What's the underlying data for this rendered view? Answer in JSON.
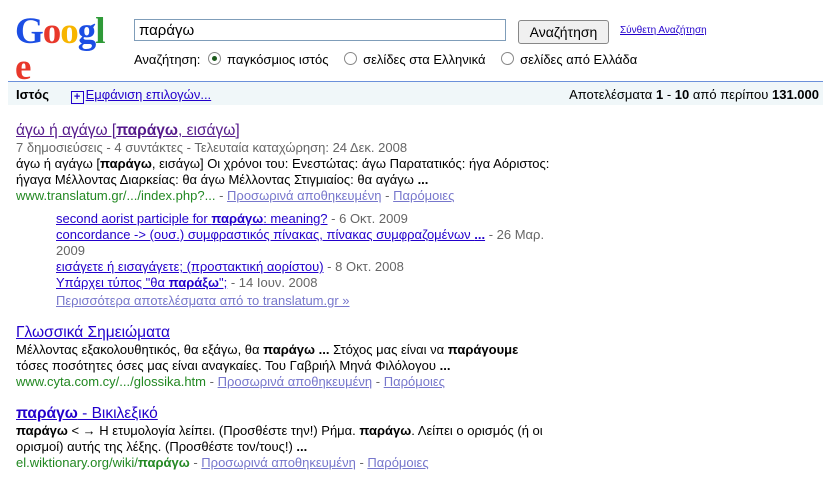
{
  "logo": "Google",
  "search": {
    "query": "παράγω",
    "button": "Αναζήτηση",
    "advanced": "Σύνθετη Αναζήτηση"
  },
  "scope": {
    "label": "Αναζήτηση:",
    "options": [
      "παγκόσμιος ιστός",
      "σελίδες στα Ελληνικά",
      "σελίδες από Ελλάδα"
    ],
    "selected": 0
  },
  "bar": {
    "tab": "Ιστός",
    "options_link": "Εμφάνιση επιλογών...",
    "stats_prefix": "Αποτελέσματα",
    "from": "1",
    "dash": "-",
    "to": "10",
    "about": "από περίπου",
    "total": "131.000"
  },
  "results": [
    {
      "title_pre": "άγω ή αγάγω [",
      "title_bold": "παράγω",
      "title_post": ", εισάγω]",
      "meta": "7 δημοσιεύσεις - 4 συντάκτες - Τελευταία καταχώρηση: 24 Δεκ. 2008",
      "snip1_pre": "άγω ή αγάγω [",
      "snip1_bold": "παράγω",
      "snip1_post": ", εισάγω] Οι χρόνοι του: Ενεστώτας: άγω Παρατατικός: ήγα Αόριστος:",
      "snip2_pre": "ήγαγα Μέλλοντας Διαρκείας: θα άγω Μέλλοντας Στιγμιαίος: θα αγάγω ",
      "snip2_bold": "...",
      "url": "www.translatum.gr/.../index.php?...",
      "cache": "Προσωρινά αποθηκευμένη",
      "similar": "Παρόμοιες",
      "sub": [
        {
          "pre": "second aorist participle for ",
          "bold": "παράγω",
          "post": ": meaning?",
          "date": "- 6 Οκτ. 2009"
        },
        {
          "pre": "concordance -> (ουσ.) συμφραστικός πίνακας, πίνακας συμφραζομένων ",
          "bold": "...",
          "post": "",
          "date": "- 26 Μαρ.",
          "date2": "2009"
        },
        {
          "pre": "εισάγετε ή εισαγάγετε; (προστακτική αορίστου)",
          "bold": "",
          "post": "",
          "date": "- 8 Οκτ. 2008"
        },
        {
          "pre": "Υπάρχει τύπος \"θα ",
          "bold": "παράξω",
          "post": "\";",
          "date": "- 14 Ιουν. 2008"
        }
      ],
      "more": "Περισσότερα αποτελέσματα από το translatum.gr »"
    },
    {
      "title": "Γλωσσικά Σημειώματα",
      "snip1_pre": "Μέλλοντας εξακολουθητικός, θα εξάγω, θα ",
      "snip1_bold": "παράγω ...",
      "snip1_mid": " Στόχος μας είναι να ",
      "snip1_bold2": "παράγουμε",
      "snip2_pre": "τόσες ποσότητες όσες μας είναι αναγκαίες. Του Γαβριήλ Μηνά Φιλόλογου ",
      "snip2_bold": "...",
      "url": "www.cyta.com.cy/.../glossika.htm",
      "cache": "Προσωρινά αποθηκευμένη",
      "similar": "Παρόμοιες"
    },
    {
      "title_bold": "παράγω",
      "title_post": " - Βικιλεξικό",
      "snip1_pre": "παράγω",
      "snip1_post": " < → Η ετυμολογία λείπει. (Προσθέστε την!) Ρήμα. ",
      "snip1_bold2": "παράγω",
      "snip1_end": ". Λείπει ο ορισμός (ή οι",
      "snip2_pre": "ορισμοί) αυτής της λέξης. (Προσθέστε τον/τους!) ",
      "snip2_bold": "...",
      "url_pre": "el.wiktionary.org/wiki/",
      "url_bold": "παράγω",
      "cache": "Προσωρινά αποθηκευμένη",
      "similar": "Παρόμοιες"
    }
  ],
  "colors": {
    "link": "#2200cc",
    "url": "#228822",
    "bar_bg": "#f0f7f9",
    "bar_border": "#6b90da"
  }
}
